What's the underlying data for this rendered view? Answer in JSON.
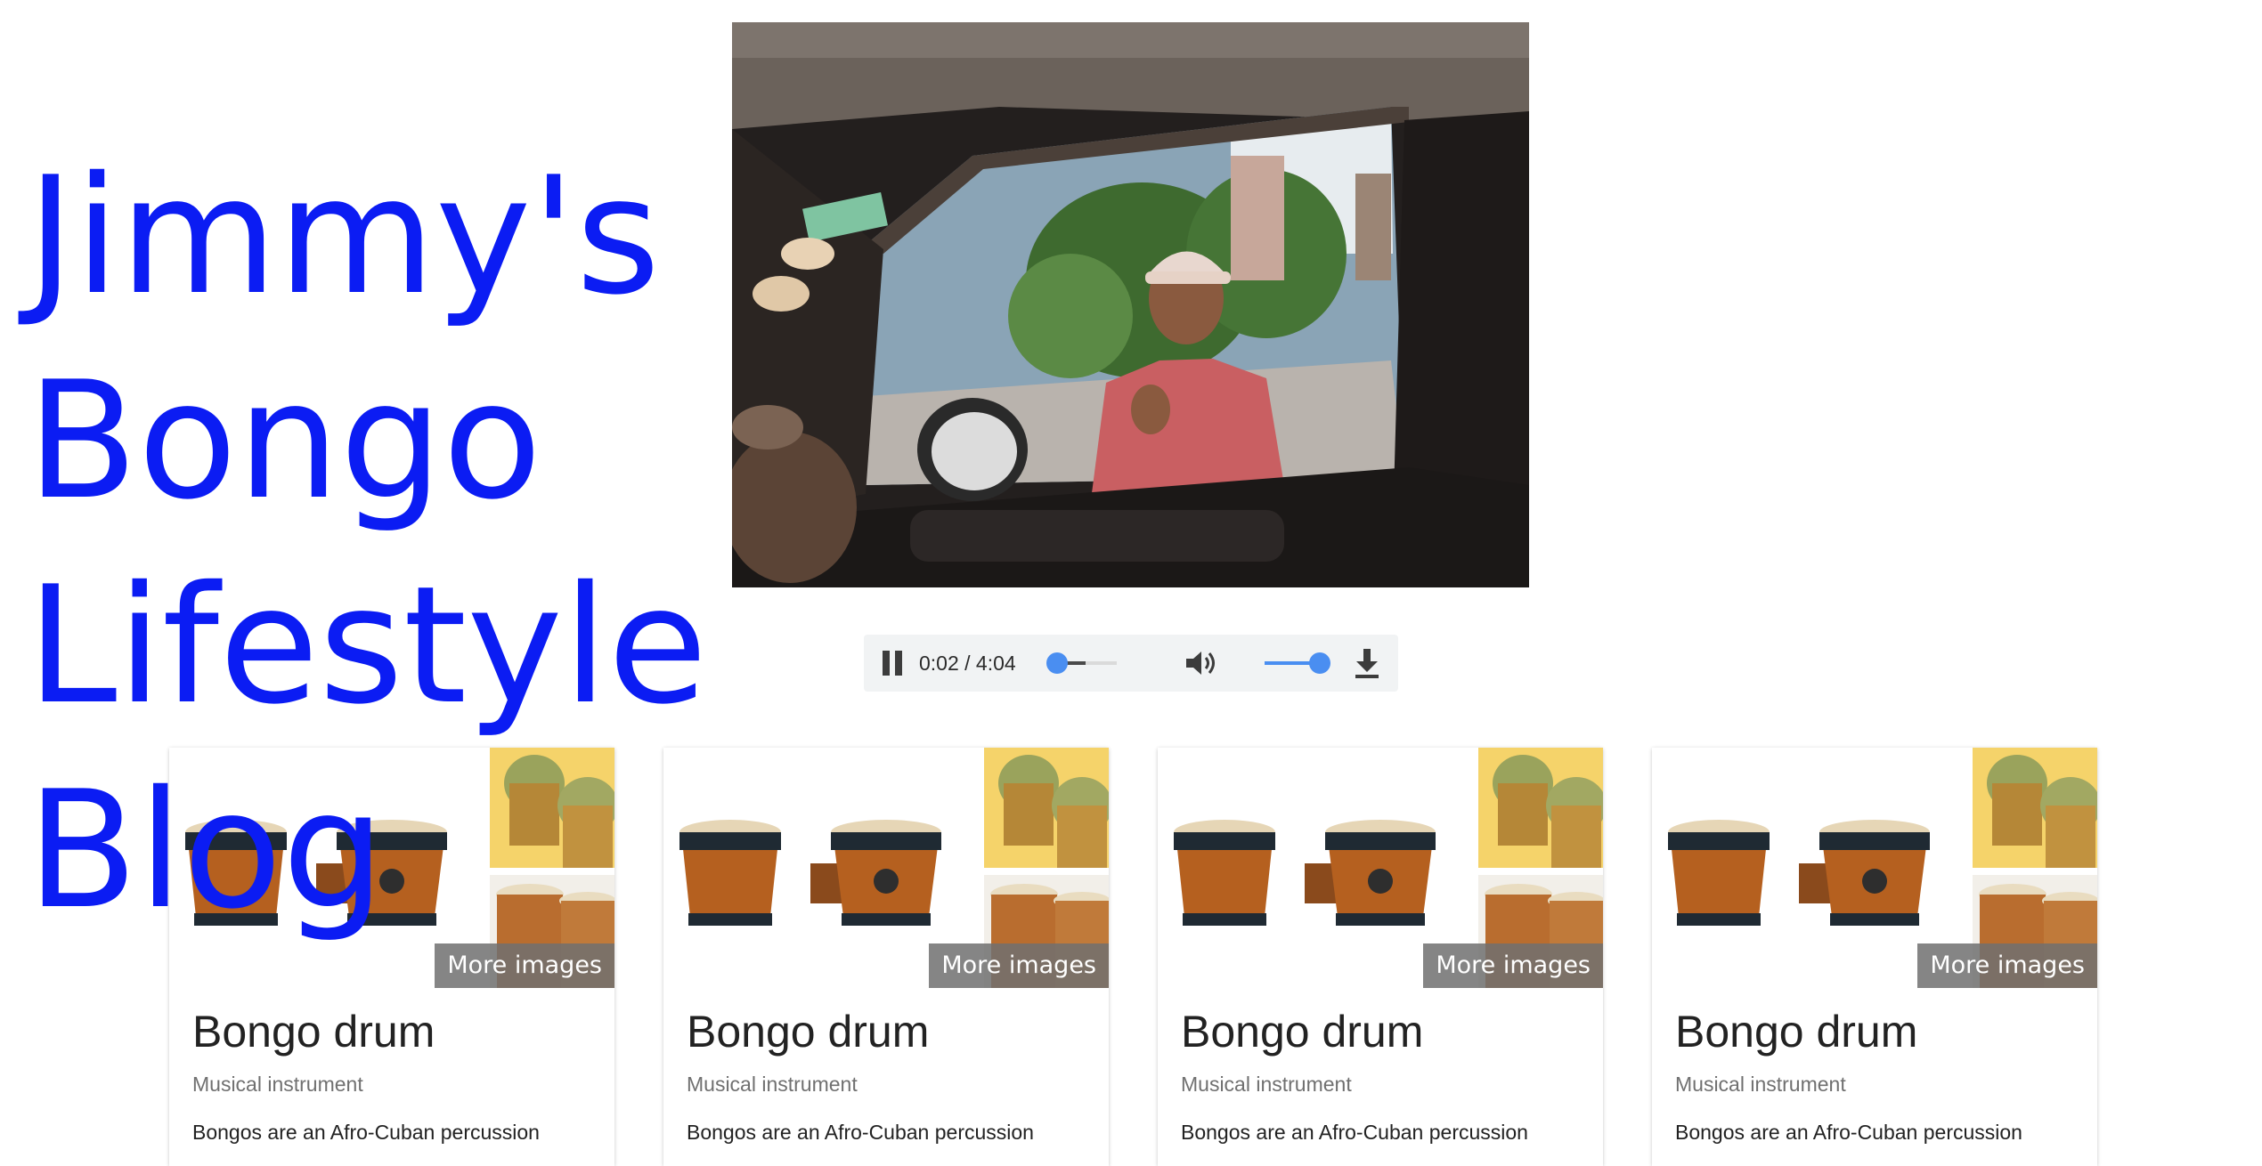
{
  "blog": {
    "title": "Jimmy's Bongo Lifestyle Blog",
    "title_color": "#0b1cf3"
  },
  "video": {
    "description_icon": "video-frame",
    "controls": {
      "play_state_icon": "pause-icon",
      "time": "0:02 / 4:04",
      "progress_fraction": 0.0083,
      "volume_fraction": 1.0,
      "volume_icon": "volume-icon",
      "download_icon": "download-icon",
      "accent_color": "#4a8ef1"
    }
  },
  "cards": [
    {
      "more_images": "More images",
      "title": "Bongo drum",
      "subtitle": "Musical instrument",
      "description": "Bongos are an Afro-Cuban percussion"
    },
    {
      "more_images": "More images",
      "title": "Bongo drum",
      "subtitle": "Musical instrument",
      "description": "Bongos are an Afro-Cuban percussion"
    },
    {
      "more_images": "More images",
      "title": "Bongo drum",
      "subtitle": "Musical instrument",
      "description": "Bongos are an Afro-Cuban percussion"
    },
    {
      "more_images": "More images",
      "title": "Bongo drum",
      "subtitle": "Musical instrument",
      "description": "Bongos are an Afro-Cuban percussion"
    }
  ]
}
